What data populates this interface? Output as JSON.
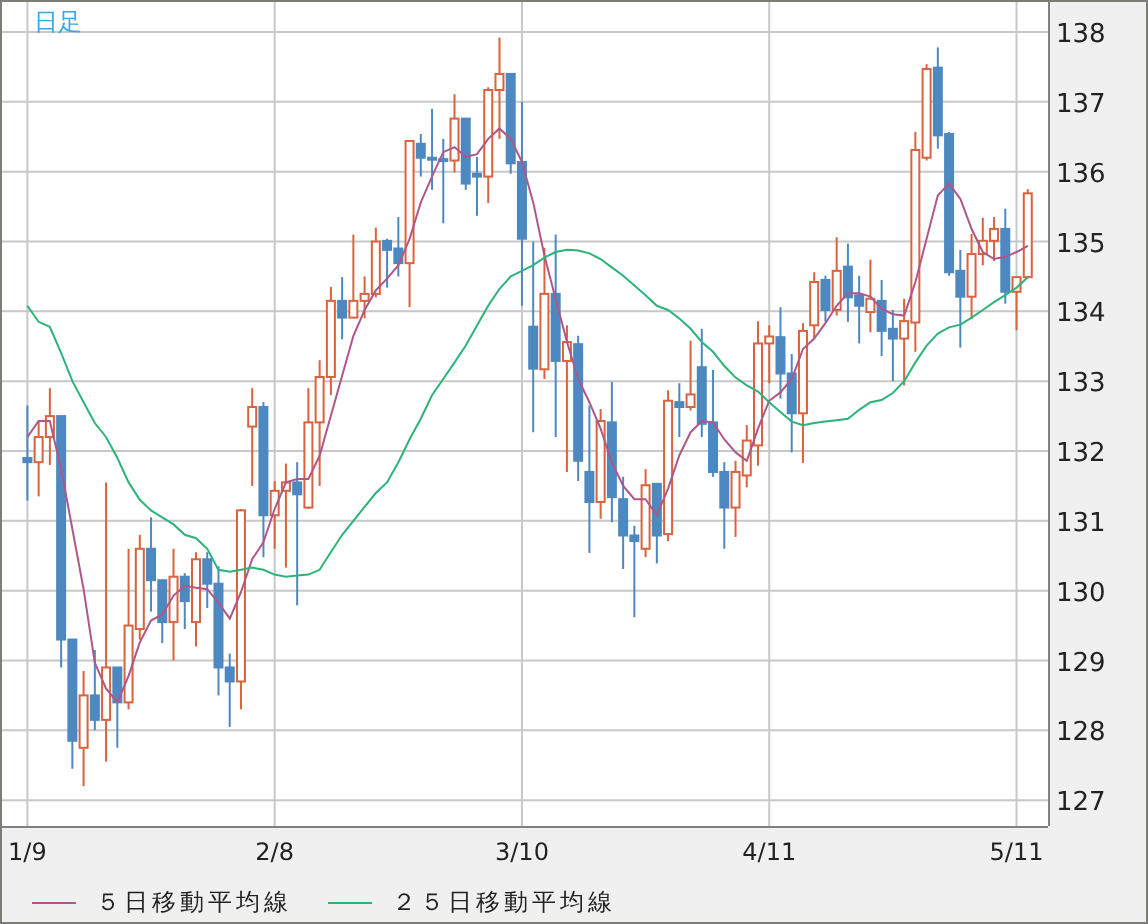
{
  "chart": {
    "period_label": "日足",
    "chart_data": {
      "type": "candlestick",
      "grid": true,
      "ylim": [
        126.63,
        138.43
      ],
      "categories": [
        "1/9",
        null,
        null,
        null,
        null,
        null,
        null,
        null,
        null,
        null,
        null,
        null,
        null,
        null,
        null,
        null,
        null,
        null,
        null,
        null,
        null,
        null,
        "2/8",
        null,
        null,
        null,
        null,
        null,
        null,
        null,
        null,
        null,
        null,
        null,
        null,
        null,
        null,
        null,
        null,
        null,
        null,
        null,
        null,
        null,
        "3/10",
        null,
        null,
        null,
        null,
        null,
        null,
        null,
        null,
        null,
        null,
        null,
        null,
        null,
        null,
        null,
        null,
        null,
        null,
        null,
        null,
        null,
        "4/11",
        null,
        null,
        null,
        null,
        null,
        null,
        null,
        null,
        null,
        null,
        null,
        null,
        null,
        null,
        null,
        null,
        null,
        null,
        null,
        null,
        null,
        "5/11",
        null
      ],
      "yticks": [
        127,
        128,
        129,
        130,
        131,
        132,
        133,
        134,
        135,
        136,
        137,
        138
      ],
      "ohlc": [
        [
          131.9,
          132.65,
          131.29,
          131.84
        ],
        [
          131.84,
          132.43,
          131.35,
          132.2
        ],
        [
          132.2,
          132.9,
          131.8,
          132.5
        ],
        [
          132.5,
          132.5,
          128.9,
          129.3
        ],
        [
          129.3,
          129.3,
          127.45,
          127.85
        ],
        [
          127.75,
          128.85,
          127.2,
          128.5
        ],
        [
          128.5,
          129.15,
          128.0,
          128.15
        ],
        [
          128.15,
          131.55,
          127.55,
          128.9
        ],
        [
          128.9,
          128.9,
          127.75,
          128.4
        ],
        [
          128.4,
          130.6,
          128.3,
          129.5
        ],
        [
          129.45,
          130.8,
          129.3,
          130.6
        ],
        [
          130.6,
          131.05,
          129.7,
          130.15
        ],
        [
          130.15,
          130.15,
          129.25,
          129.55
        ],
        [
          129.55,
          130.6,
          129.0,
          130.2
        ],
        [
          130.2,
          130.25,
          129.45,
          129.85
        ],
        [
          129.55,
          130.55,
          129.2,
          130.45
        ],
        [
          130.45,
          130.55,
          129.75,
          130.1
        ],
        [
          130.1,
          130.35,
          128.5,
          128.9
        ],
        [
          128.9,
          129.1,
          128.05,
          128.7
        ],
        [
          128.7,
          131.17,
          128.3,
          131.15
        ],
        [
          132.35,
          132.9,
          131.5,
          132.63
        ],
        [
          132.63,
          132.7,
          130.48,
          131.08
        ],
        [
          131.08,
          131.57,
          130.6,
          131.43
        ],
        [
          131.43,
          131.82,
          130.33,
          131.55
        ],
        [
          131.55,
          131.84,
          129.79,
          131.38
        ],
        [
          131.19,
          132.9,
          131.17,
          132.41
        ],
        [
          132.41,
          133.3,
          131.5,
          133.06
        ],
        [
          133.06,
          134.35,
          132.8,
          134.15
        ],
        [
          134.15,
          134.49,
          133.6,
          133.91
        ],
        [
          133.91,
          135.1,
          133.91,
          134.15
        ],
        [
          134.15,
          134.5,
          133.9,
          134.25
        ],
        [
          134.25,
          135.2,
          134.2,
          135.0
        ],
        [
          135.01,
          135.04,
          134.34,
          134.88
        ],
        [
          134.9,
          135.35,
          134.5,
          134.69
        ],
        [
          134.69,
          136.44,
          134.06,
          136.44
        ],
        [
          136.4,
          136.54,
          135.93,
          136.2
        ],
        [
          136.2,
          136.9,
          135.74,
          136.18
        ],
        [
          136.18,
          136.47,
          135.26,
          136.16
        ],
        [
          136.16,
          137.11,
          135.99,
          136.76
        ],
        [
          136.76,
          136.76,
          135.74,
          135.83
        ],
        [
          135.97,
          136.21,
          135.37,
          135.93
        ],
        [
          135.93,
          137.21,
          135.55,
          137.17
        ],
        [
          137.17,
          137.92,
          136.47,
          137.4
        ],
        [
          137.4,
          137.4,
          135.97,
          136.12
        ],
        [
          136.14,
          137.0,
          134.08,
          135.04
        ],
        [
          133.78,
          135.0,
          132.27,
          133.18
        ],
        [
          133.17,
          134.91,
          133.03,
          134.25
        ],
        [
          134.25,
          135.1,
          132.2,
          133.29
        ],
        [
          133.29,
          133.8,
          131.7,
          133.56
        ],
        [
          133.53,
          133.65,
          131.57,
          131.86
        ],
        [
          131.7,
          132.65,
          130.54,
          131.27
        ],
        [
          131.27,
          132.6,
          131.03,
          132.43
        ],
        [
          132.41,
          132.99,
          130.98,
          131.34
        ],
        [
          131.31,
          131.63,
          130.31,
          130.79
        ],
        [
          130.79,
          130.93,
          129.62,
          130.71
        ],
        [
          130.6,
          131.74,
          130.48,
          131.51
        ],
        [
          131.53,
          131.53,
          130.39,
          130.79
        ],
        [
          130.81,
          132.87,
          130.71,
          132.72
        ],
        [
          132.7,
          132.97,
          132.2,
          132.63
        ],
        [
          132.63,
          133.58,
          132.58,
          132.81
        ],
        [
          133.2,
          133.75,
          132.2,
          132.39
        ],
        [
          132.41,
          133.16,
          131.63,
          131.7
        ],
        [
          131.7,
          131.84,
          130.6,
          131.19
        ],
        [
          131.19,
          131.86,
          130.77,
          131.7
        ],
        [
          131.65,
          132.37,
          131.48,
          132.15
        ],
        [
          132.08,
          133.86,
          131.79,
          133.54
        ],
        [
          133.54,
          133.8,
          132.97,
          133.64
        ],
        [
          133.63,
          134.06,
          132.75,
          133.11
        ],
        [
          133.11,
          133.39,
          131.98,
          132.54
        ],
        [
          132.54,
          133.83,
          131.83,
          133.72
        ],
        [
          133.8,
          134.56,
          133.61,
          134.42
        ],
        [
          134.45,
          134.51,
          133.85,
          134.02
        ],
        [
          134.02,
          135.06,
          133.94,
          134.58
        ],
        [
          134.64,
          134.97,
          133.85,
          134.2
        ],
        [
          134.23,
          134.51,
          133.54,
          134.08
        ],
        [
          133.99,
          134.74,
          133.7,
          134.18
        ],
        [
          134.15,
          134.45,
          133.36,
          133.72
        ],
        [
          133.75,
          134.02,
          133.0,
          133.61
        ],
        [
          133.61,
          134.18,
          132.94,
          133.86
        ],
        [
          133.84,
          136.57,
          133.42,
          136.31
        ],
        [
          136.2,
          137.54,
          136.16,
          137.47
        ],
        [
          137.49,
          137.78,
          136.33,
          136.52
        ],
        [
          136.54,
          136.57,
          134.51,
          134.56
        ],
        [
          134.58,
          134.88,
          133.48,
          134.21
        ],
        [
          134.21,
          135.11,
          133.89,
          134.82
        ],
        [
          134.82,
          135.34,
          134.66,
          135.01
        ],
        [
          135.01,
          135.35,
          134.72,
          135.18
        ],
        [
          135.18,
          135.47,
          134.11,
          134.28
        ],
        [
          134.28,
          134.49,
          133.73,
          134.49
        ],
        [
          134.49,
          135.75,
          134.49,
          135.69
        ]
      ],
      "series": [
        {
          "name": "５日移動平均線",
          "type": "line",
          "color": "#b0578a",
          "values": [
            132.2,
            132.43,
            132.43,
            131.74,
            130.88,
            130.02,
            128.97,
            128.6,
            128.4,
            128.78,
            129.26,
            129.57,
            129.66,
            129.93,
            130.07,
            130.04,
            130.02,
            129.83,
            129.6,
            129.98,
            130.45,
            130.69,
            131.17,
            131.55,
            131.6,
            131.6,
            131.93,
            132.5,
            133.08,
            133.65,
            134.02,
            134.3,
            134.47,
            134.66,
            135.04,
            135.56,
            135.93,
            136.28,
            136.35,
            136.21,
            136.25,
            136.47,
            136.62,
            136.47,
            136.14,
            135.56,
            134.8,
            134.18,
            133.56,
            133.03,
            132.7,
            132.32,
            131.84,
            131.5,
            131.31,
            131.31,
            131.08,
            131.46,
            131.94,
            132.27,
            132.43,
            132.41,
            132.17,
            131.98,
            131.86,
            132.32,
            132.72,
            132.84,
            133.03,
            133.46,
            133.61,
            133.83,
            134.08,
            134.26,
            134.26,
            134.21,
            134.04,
            133.96,
            133.94,
            134.42,
            135.04,
            135.66,
            135.83,
            135.61,
            135.18,
            134.85,
            134.75,
            134.78,
            134.85,
            134.94
          ]
        },
        {
          "name": "２５日移動平均線",
          "type": "line",
          "color": "#2cb37a",
          "values": [
            134.08,
            133.85,
            133.78,
            133.4,
            133.0,
            132.7,
            132.4,
            132.2,
            131.9,
            131.55,
            131.3,
            131.15,
            131.05,
            130.95,
            130.8,
            130.75,
            130.6,
            130.3,
            130.27,
            130.3,
            130.33,
            130.3,
            130.23,
            130.2,
            130.22,
            130.23,
            130.3,
            130.55,
            130.8,
            131.0,
            131.2,
            131.4,
            131.55,
            131.84,
            132.17,
            132.46,
            132.8,
            133.03,
            133.27,
            133.51,
            133.8,
            134.08,
            134.32,
            134.5,
            134.58,
            134.66,
            134.77,
            134.85,
            134.88,
            134.87,
            134.83,
            134.75,
            134.63,
            134.51,
            134.37,
            134.23,
            134.08,
            134.02,
            133.9,
            133.75,
            133.56,
            133.42,
            133.22,
            133.05,
            132.94,
            132.85,
            132.7,
            132.56,
            132.42,
            132.37,
            132.4,
            132.42,
            132.44,
            132.46,
            132.59,
            132.7,
            132.73,
            132.83,
            133.0,
            133.27,
            133.51,
            133.68,
            133.77,
            133.81,
            133.91,
            134.02,
            134.13,
            134.23,
            134.34,
            134.49
          ]
        }
      ]
    }
  }
}
